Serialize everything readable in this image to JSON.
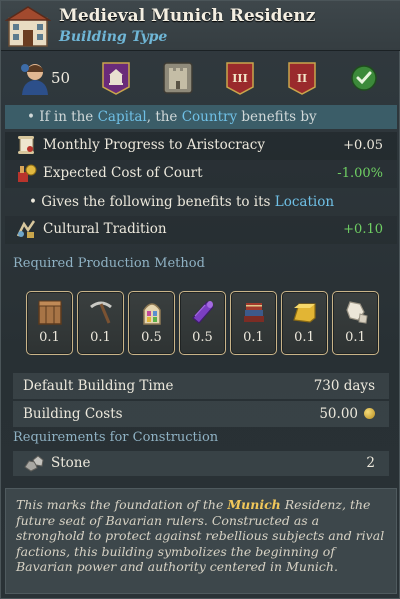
{
  "header": {
    "title": "Medieval Munich Residenz",
    "subtitle": "Building Type"
  },
  "icon_row": {
    "portrait_value": "50",
    "icons": [
      "palace-icon",
      "castle-icon",
      "tier-three-icon",
      "tier-two-icon",
      "checkmark-icon"
    ],
    "tier_three_label": "III",
    "tier_two_label": "II"
  },
  "capital": {
    "prefix": "• If in the ",
    "capital_word": "Capital",
    "middle": ", the ",
    "country_word": "Country",
    "suffix": " benefits by"
  },
  "modifiers": [
    {
      "label": "Monthly Progress to Aristocracy",
      "value": "+0.05",
      "tone": "neutral",
      "icon": "scroll-icon"
    },
    {
      "label": "Expected Cost of Court",
      "value": "-1.00%",
      "tone": "positive",
      "icon": "court-cost-icon"
    }
  ],
  "location": {
    "prefix": "• Gives the following benefits to its ",
    "location_word": "Location"
  },
  "location_modifiers": [
    {
      "label": "Cultural Tradition",
      "value": "+0.10",
      "tone": "positive",
      "icon": "tradition-icon"
    }
  ],
  "production": {
    "title": "Required Production Method",
    "goods": [
      {
        "icon": "crate-icon",
        "value": "0.1"
      },
      {
        "icon": "pickaxe-icon",
        "value": "0.1"
      },
      {
        "icon": "stained-glass-icon",
        "value": "0.5"
      },
      {
        "icon": "cloth-icon",
        "value": "0.5"
      },
      {
        "icon": "books-icon",
        "value": "0.1"
      },
      {
        "icon": "gold-ingot-icon",
        "value": "0.1"
      },
      {
        "icon": "marble-icon",
        "value": "0.1"
      }
    ]
  },
  "info": {
    "build_time_label": "Default Building Time",
    "build_time_value": "730 days",
    "cost_label": "Building Costs",
    "cost_value": "50.00"
  },
  "requirements": {
    "title": "Requirements for Construction",
    "items": [
      {
        "icon": "stone-icon",
        "label": "Stone",
        "value": "2"
      }
    ]
  },
  "flavor": {
    "part1": "This marks the foundation of the ",
    "highlight": "Munich",
    "part2": " Residenz, the future seat of Bavarian rulers. Constructed as a stronghold to protect against rebellious subjects and rival factions, this building symbolizes the beginning of Bavarian power and authority centered in Munich."
  },
  "colors": {
    "accent_blue": "#6fc0e6",
    "positive_green": "#6fcf63",
    "gold": "#f1c75a",
    "band_blue": "#3b5d68"
  }
}
